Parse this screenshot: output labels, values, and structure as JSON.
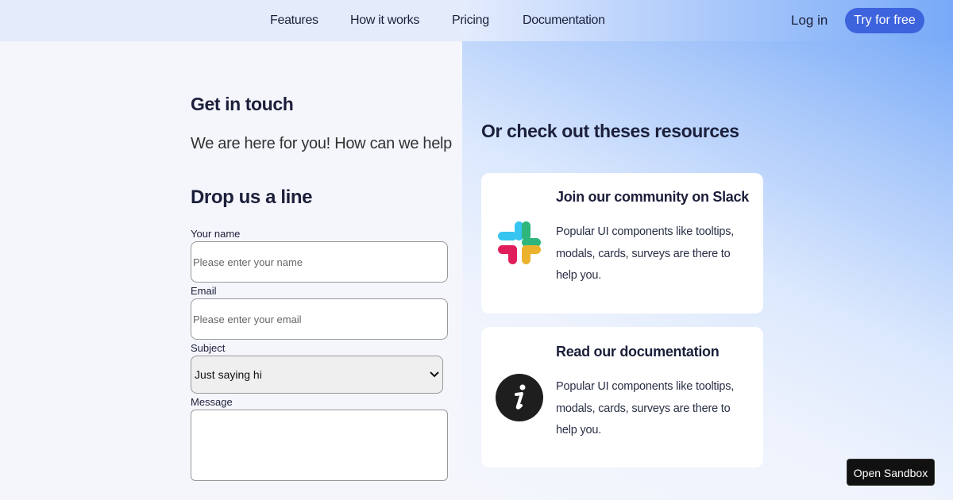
{
  "nav": {
    "links": [
      "Features",
      "How it works",
      "Pricing",
      "Documentation"
    ],
    "login_label": "Log in",
    "cta_label": "Try for free"
  },
  "contact": {
    "title": "Get in touch",
    "subtitle": "We are here for you! How can we help",
    "form_title": "Drop us a line",
    "name_label": "Your name",
    "name_placeholder": "Please enter your name",
    "email_label": "Email",
    "email_placeholder": "Please enter your email",
    "subject_label": "Subject",
    "subject_value": "Just saying hi",
    "message_label": "Message",
    "message_value": ""
  },
  "resources": {
    "title": "Or check out theses resources",
    "cards": [
      {
        "icon": "slack-icon",
        "title": "Join our community on Slack",
        "text": "Popular UI components like tooltips, modals, cards, surveys are there to help you."
      },
      {
        "icon": "info-icon",
        "title": "Read our documentation",
        "text": "Popular UI components like tooltips, modals, cards, surveys are there to help you."
      }
    ]
  },
  "sandbox_label": "Open Sandbox",
  "colors": {
    "primary": "#3d63dd",
    "text_dark": "#1b1f3a",
    "gradient_blue": "#6ea4f7",
    "slack_blue": "#36c5f0",
    "slack_green": "#2eb67d",
    "slack_red": "#e01e5a",
    "slack_yellow": "#ecb22e"
  }
}
